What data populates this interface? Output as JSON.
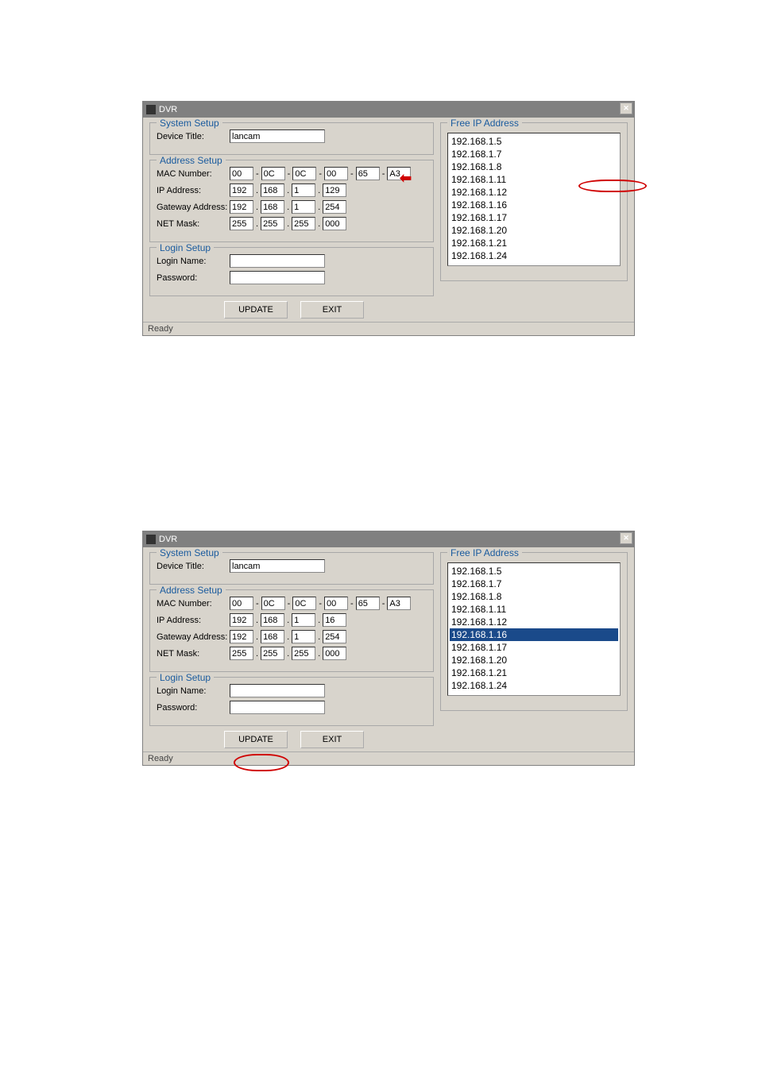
{
  "window_title": "DVR",
  "groups": {
    "system": "System Setup",
    "address": "Address Setup",
    "login": "Login Setup",
    "free_ip": "Free IP Address"
  },
  "labels": {
    "device_title": "Device Title:",
    "mac_number": "MAC Number:",
    "ip_address": "IP Address:",
    "gateway": "Gateway Address:",
    "netmask": "NET Mask:",
    "login_name": "Login Name:",
    "password": "Password:"
  },
  "buttons": {
    "update": "UPDATE",
    "exit": "EXIT"
  },
  "status": "Ready",
  "dialog1": {
    "device_title": "lancam",
    "mac": [
      "00",
      "0C",
      "0C",
      "00",
      "65",
      "A3"
    ],
    "ip": [
      "192",
      "168",
      "1",
      "129"
    ],
    "gateway": [
      "192",
      "168",
      "1",
      "254"
    ],
    "netmask": [
      "255",
      "255",
      "255",
      "000"
    ],
    "login_name": "",
    "password": "",
    "free_ips": [
      "192.168.1.5",
      "192.168.1.7",
      "192.168.1.8",
      "192.168.1.11",
      "192.168.1.12",
      "192.168.1.16",
      "192.168.1.17",
      "192.168.1.20",
      "192.168.1.21",
      "192.168.1.24"
    ]
  },
  "dialog2": {
    "device_title": "lancam",
    "mac": [
      "00",
      "0C",
      "0C",
      "00",
      "65",
      "A3"
    ],
    "ip": [
      "192",
      "168",
      "1",
      "16"
    ],
    "gateway": [
      "192",
      "168",
      "1",
      "254"
    ],
    "netmask": [
      "255",
      "255",
      "255",
      "000"
    ],
    "login_name": "",
    "password": "",
    "free_ips": [
      "192.168.1.5",
      "192.168.1.7",
      "192.168.1.8",
      "192.168.1.11",
      "192.168.1.12",
      "192.168.1.16",
      "192.168.1.17",
      "192.168.1.20",
      "192.168.1.21",
      "192.168.1.24"
    ],
    "selected_ip_index": 5
  }
}
